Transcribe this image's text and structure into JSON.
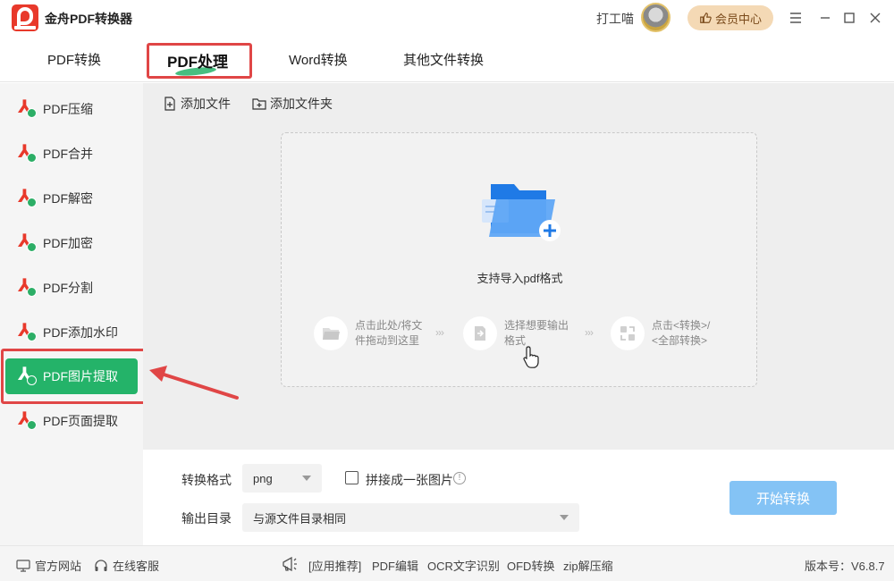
{
  "app": {
    "title": "金舟PDF转换器"
  },
  "user": {
    "name": "打工喵"
  },
  "vip": {
    "label": "会员中心"
  },
  "tabs": [
    {
      "label": "PDF转换"
    },
    {
      "label": "PDF处理"
    },
    {
      "label": "Word转换"
    },
    {
      "label": "其他文件转换"
    }
  ],
  "sidebar": {
    "items": [
      {
        "label": "PDF压缩"
      },
      {
        "label": "PDF合并"
      },
      {
        "label": "PDF解密"
      },
      {
        "label": "PDF加密"
      },
      {
        "label": "PDF分割"
      },
      {
        "label": "PDF添加水印"
      },
      {
        "label": "PDF图片提取"
      },
      {
        "label": "PDF页面提取"
      }
    ]
  },
  "toolbar": {
    "add_file": "添加文件",
    "add_folder": "添加文件夹"
  },
  "dropzone": {
    "hint": "支持导入pdf格式",
    "step1_line1": "点击此处/将文",
    "step1_line2": "件拖动到这里",
    "step2_line1": "选择想要输出",
    "step2_line2": "格式",
    "step3_line1": "点击<转换>/",
    "step3_line2": "<全部转换>",
    "separator": "›››"
  },
  "options": {
    "format_label": "转换格式",
    "format_value": "png",
    "merge_label": "拼接成一张图片",
    "merge_checked": false,
    "output_label": "输出目录",
    "output_value": "与源文件目录相同",
    "start_label": "开始转换"
  },
  "footer": {
    "site": "官方网站",
    "service": "在线客服",
    "promo": "[应用推荐]",
    "links": [
      "PDF编辑",
      "OCR文字识别",
      "OFD转换",
      "zip解压缩"
    ],
    "version": "版本号：V6.8.7"
  },
  "colors": {
    "accent_green": "#24b369",
    "highlight_red": "#e04646",
    "start_button": "#84c3f5",
    "vip_bg": "#f4d9b5"
  }
}
